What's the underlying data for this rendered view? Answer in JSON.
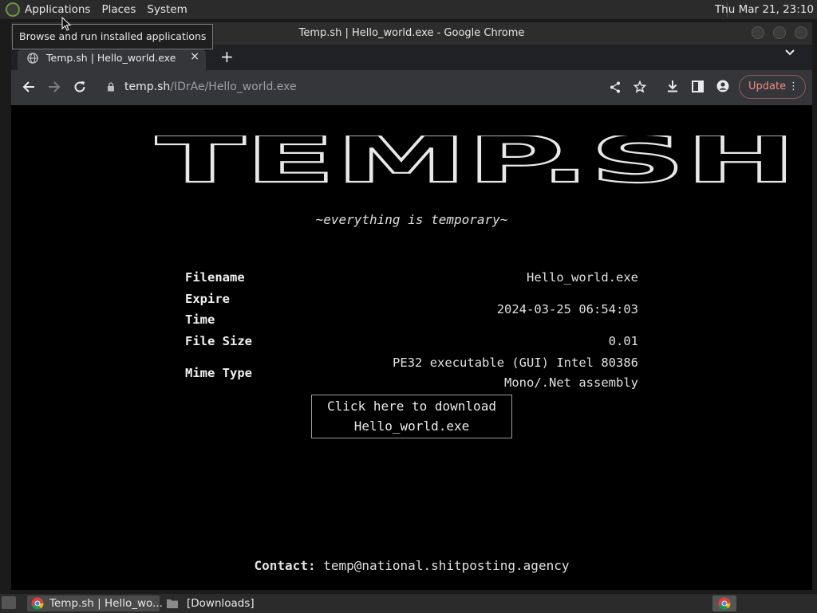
{
  "top_panel": {
    "menus": [
      "Applications",
      "Places",
      "System"
    ],
    "clock": "Thu Mar 21, 23:10",
    "tooltip": "Browse and run installed applications"
  },
  "window": {
    "title": "Temp.sh | Hello_world.exe - Google Chrome"
  },
  "tab": {
    "title": "Temp.sh | Hello_world.exe",
    "close_label": "×",
    "new_tab_label": "+",
    "list_label": "⌄"
  },
  "toolbar": {
    "url_host": "temp.sh",
    "url_path": "/IDrAe/Hello_world.exe",
    "update_label": "Update"
  },
  "page": {
    "logo_text": "TEMP.SH",
    "tagline": "~everything is temporary~",
    "rows": [
      {
        "label": "Filename",
        "value": "Hello_world.exe"
      },
      {
        "label": "Expire",
        "label2": "Time",
        "value": "2024-03-25 06:54:03"
      },
      {
        "label": "File Size",
        "value": "0.01"
      },
      {
        "label": "Mime Type",
        "value": "PE32 executable (GUI) Intel 80386",
        "value2": "Mono/.Net assembly"
      }
    ],
    "download": {
      "line1": "Click here to download",
      "line2": "Hello_world.exe"
    },
    "contact_label": "Contact:",
    "contact_value": "temp@national.shitposting.agency"
  },
  "taskbar": {
    "items": [
      "Temp.sh | Hello_wo...",
      "[Downloads]"
    ]
  },
  "colors": {
    "page_bg": "#000000",
    "update_accent": "#f28b82",
    "chrome_toolbar": "#35363a"
  }
}
